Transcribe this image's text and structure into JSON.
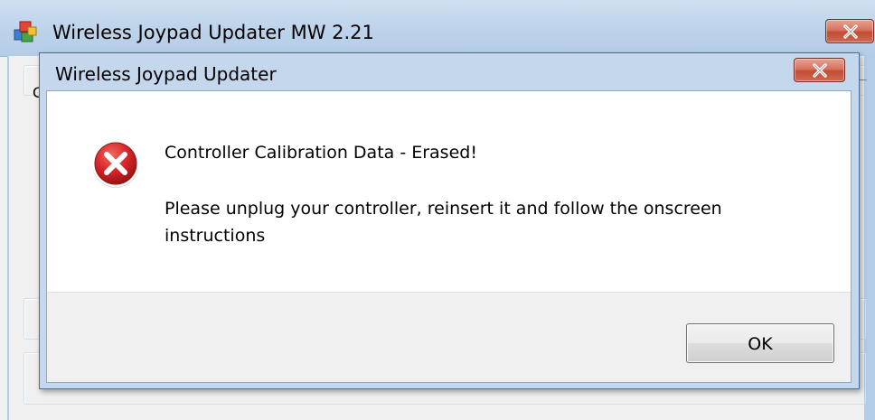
{
  "parent_window": {
    "title": "Wireless Joypad Updater MW 2.21",
    "icon": "app-installer-icon",
    "partial_label_char": "C"
  },
  "dialog": {
    "title": "Wireless Joypad Updater",
    "icon": "error-icon",
    "message_main": "Controller Calibration Data - Erased!",
    "message_detail": "Please unplug your controller, reinsert it and follow the onscreen instructions",
    "ok_label": "OK"
  },
  "colors": {
    "titlebar": "#bcd3ea",
    "close_button": "#c24d35",
    "error_red": "#d9262c",
    "button_area": "#f0f0f0"
  }
}
